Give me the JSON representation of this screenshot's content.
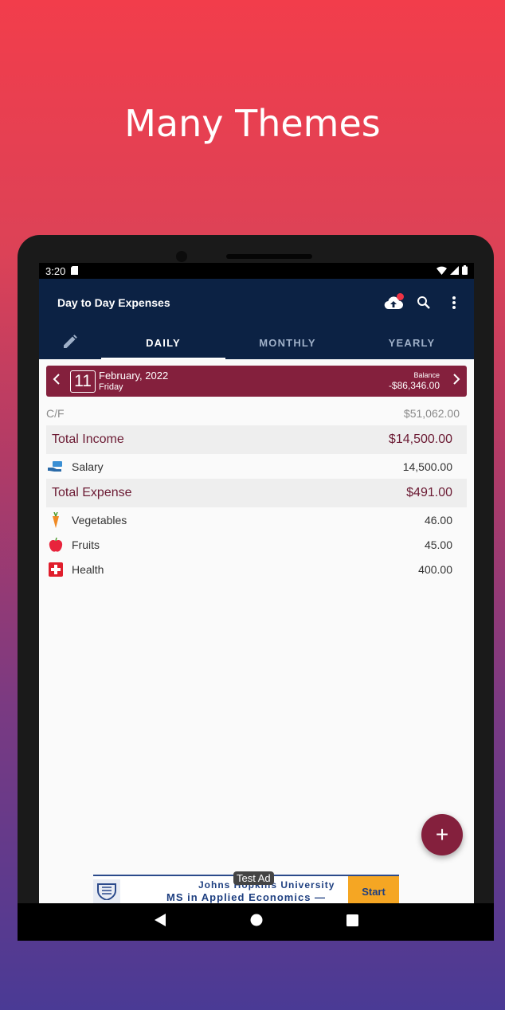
{
  "headline": "Many Themes",
  "status_bar": {
    "time": "3:20"
  },
  "app_bar": {
    "title": "Day to Day Expenses"
  },
  "tabs": [
    {
      "label": "DAILY",
      "active": true
    },
    {
      "label": "MONTHLY",
      "active": false
    },
    {
      "label": "YEARLY",
      "active": false
    }
  ],
  "date_bar": {
    "day": "11",
    "month_year": "February, 2022",
    "weekday": "Friday",
    "balance_label": "Balance",
    "balance_value": "-$86,346.00"
  },
  "carry_forward": {
    "label": "C/F",
    "value": "$51,062.00"
  },
  "income": {
    "label": "Total Income",
    "total": "$14,500.00",
    "items": [
      {
        "name": "Salary",
        "amount": "14,500.00",
        "icon": "money-hand-icon"
      }
    ]
  },
  "expense": {
    "label": "Total Expense",
    "total": "$491.00",
    "items": [
      {
        "name": "Vegetables",
        "amount": "46.00",
        "icon": "carrot-icon"
      },
      {
        "name": "Fruits",
        "amount": "45.00",
        "icon": "apple-icon"
      },
      {
        "name": "Health",
        "amount": "400.00",
        "icon": "health-cross-icon"
      }
    ]
  },
  "fab": {
    "label": "+"
  },
  "ad": {
    "tag": "Test Ad",
    "line1": "Johns Hopkins University",
    "line2": "MS in Applied Economics —",
    "cta": "Start"
  },
  "colors": {
    "primary": "#0c2244",
    "accent": "#84203d",
    "gradient_top": "#f23d4b",
    "gradient_bottom": "#4a3a95"
  }
}
